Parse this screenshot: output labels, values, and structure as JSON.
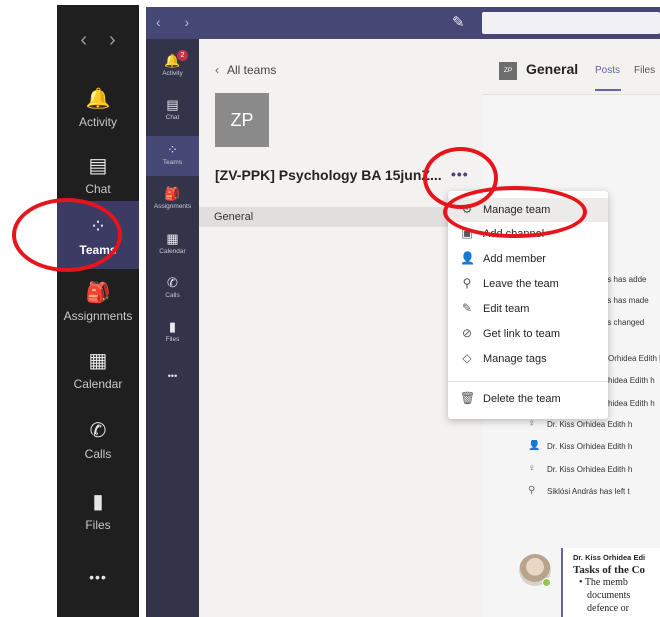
{
  "big_rail": {
    "nav_back": "‹",
    "nav_forward": "›",
    "items": [
      {
        "label": "Activity",
        "icon": "bell-icon",
        "glyph": "🔔"
      },
      {
        "label": "Chat",
        "icon": "chat-icon",
        "glyph": "▤"
      },
      {
        "label": "Teams",
        "icon": "teams-icon",
        "glyph": "⁘"
      },
      {
        "label": "Assignments",
        "icon": "assignments-icon",
        "glyph": "🎒"
      },
      {
        "label": "Calendar",
        "icon": "calendar-icon",
        "glyph": "▦"
      },
      {
        "label": "Calls",
        "icon": "phone-icon",
        "glyph": "✆"
      },
      {
        "label": "Files",
        "icon": "file-icon",
        "glyph": "▮"
      },
      {
        "label": "More",
        "icon": "more-icon",
        "glyph": "•••"
      }
    ]
  },
  "small_rail": {
    "activity_badge": "2",
    "items": [
      {
        "label": "Activity",
        "icon": "bell-icon",
        "glyph": "🔔"
      },
      {
        "label": "Chat",
        "icon": "chat-icon",
        "glyph": "▤"
      },
      {
        "label": "Teams",
        "icon": "teams-icon",
        "glyph": "⁘"
      },
      {
        "label": "Assignments",
        "icon": "assignments-icon",
        "glyph": "🎒"
      },
      {
        "label": "Calendar",
        "icon": "calendar-icon",
        "glyph": "▦"
      },
      {
        "label": "Calls",
        "icon": "phone-icon",
        "glyph": "✆"
      },
      {
        "label": "Files",
        "icon": "file-icon",
        "glyph": "▮"
      },
      {
        "label": "More",
        "icon": "more-icon",
        "glyph": "•••"
      }
    ]
  },
  "top_bar": {
    "nav": "‹ ›",
    "compose_glyph": "✎"
  },
  "team_panel": {
    "back_label": "All teams",
    "avatar_initials": "ZP",
    "team_name": "[ZV-PPK] Psychology BA 15junZ...",
    "more_glyph": "•••",
    "channel": "General"
  },
  "channel_header": {
    "icon_initials": "ZP",
    "title": "General",
    "tabs": [
      "Posts",
      "Files"
    ]
  },
  "menu": {
    "items": [
      {
        "label": "Manage team",
        "icon": "gear-icon",
        "glyph": "⚙"
      },
      {
        "label": "Add channel",
        "icon": "add-channel-icon",
        "glyph": "▣"
      },
      {
        "label": "Add member",
        "icon": "add-member-icon",
        "glyph": "👤"
      },
      {
        "label": "Leave the team",
        "icon": "leave-icon",
        "glyph": "⚲"
      },
      {
        "label": "Edit team",
        "icon": "pencil-icon",
        "glyph": "✎"
      },
      {
        "label": "Get link to team",
        "icon": "link-icon",
        "glyph": "⊘"
      },
      {
        "label": "Manage tags",
        "icon": "tag-icon",
        "glyph": "◇"
      },
      {
        "label": "Delete the team",
        "icon": "trash-icon",
        "glyph": "🗑"
      }
    ]
  },
  "activity": [
    {
      "text": "Irás has adde",
      "icon": "none"
    },
    {
      "text": "Irás has made",
      "icon": "none"
    },
    {
      "text": "Irás changed",
      "icon": "none"
    },
    {
      "text": "Orhidea Edith h",
      "icon": "none"
    },
    {
      "text": "hidea Edith h",
      "icon": "none"
    },
    {
      "text": "hidea Edith h",
      "icon": "none"
    },
    {
      "text": "Dr. Kiss Orhidea Edith h",
      "icon": "ribbon-icon",
      "glyph": "♀"
    },
    {
      "text": "Dr. Kiss Orhidea Edith h",
      "icon": "add-member-icon",
      "glyph": "👤"
    },
    {
      "text": "Dr. Kiss Orhidea Edith h",
      "icon": "ribbon-icon",
      "glyph": "♀"
    },
    {
      "text": "Siklósi András has left t",
      "icon": "leave-icon",
      "glyph": "⚲"
    }
  ],
  "post": {
    "author": "Dr. Kiss Orhidea Edi",
    "title": "Tasks of the Co",
    "body_lines": [
      "• The memb",
      "documents",
      "defence or"
    ]
  }
}
